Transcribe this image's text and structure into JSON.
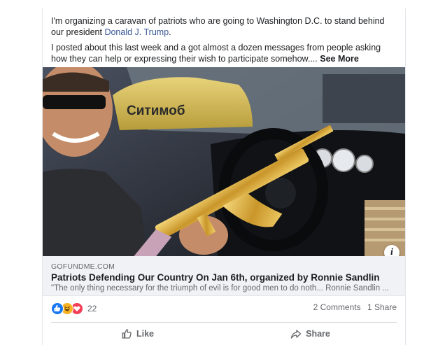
{
  "post": {
    "text_part1": "I'm organizing a caravan of patriots who are going to Washington D.C. to stand behind our president ",
    "mention": "Donald J. Trump",
    "text_part1_end": ".",
    "text_part2": "I posted about this last week and a got almost a dozen messages from people asking how they can help or expressing their wish to participate somehow.... ",
    "see_more": "See More"
  },
  "image": {
    "taxi_sign": "Ситимоб",
    "info_icon": "info-icon"
  },
  "link": {
    "domain": "GOFUNDME.COM",
    "title": "Patriots Defending Our Country On Jan 6th, organized by Ronnie Sandlin",
    "description": "\"The only thing necessary for the triumph of evil is for good men to do noth... Ronnie Sandlin ..."
  },
  "stats": {
    "reaction_icons": [
      "like-icon",
      "haha-icon",
      "love-icon"
    ],
    "reaction_count": "22",
    "comments": "2 Comments",
    "shares": "1 Share"
  },
  "actions": {
    "like_label": "Like",
    "share_label": "Share"
  },
  "colors": {
    "link_blue": "#385898",
    "like_blue": "#1877f2",
    "haha_yellow": "#f7b125",
    "love_red": "#f33e58",
    "meta_bg": "#f0f2f5",
    "secondary_text": "#65676b"
  }
}
